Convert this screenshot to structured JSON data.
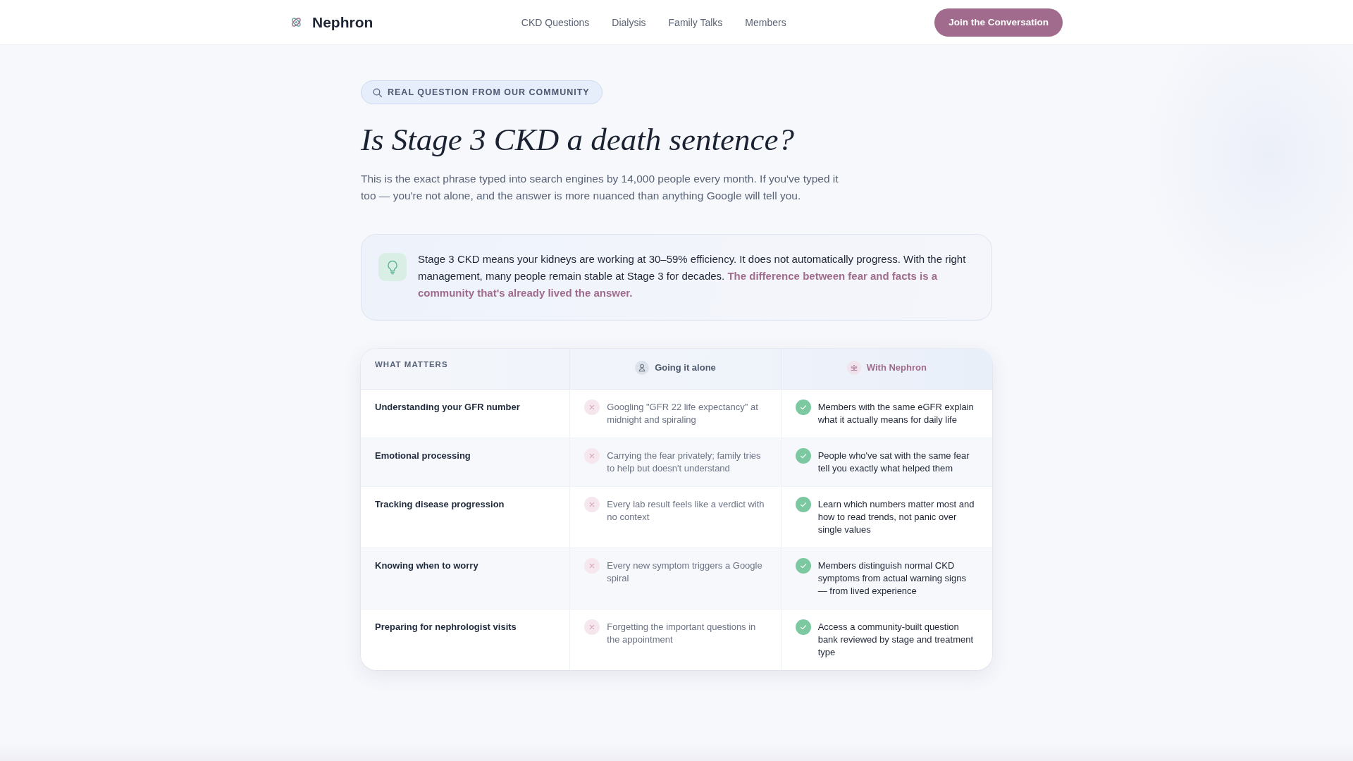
{
  "header": {
    "brand": "Nephron",
    "nav": [
      {
        "label": "CKD Questions"
      },
      {
        "label": "Dialysis"
      },
      {
        "label": "Family Talks"
      },
      {
        "label": "Members"
      }
    ],
    "cta": "Join the Conversation"
  },
  "hero": {
    "badge": "REAL QUESTION FROM OUR COMMUNITY",
    "title": "Is Stage 3 CKD a death sentence?",
    "intro": "This is the exact phrase typed into search engines by 14,000 people every month. If you've typed it too — you're not alone, and the answer is more nuanced than anything Google will tell you."
  },
  "callout": {
    "text": "Stage 3 CKD means your kidneys are working at 30–59% efficiency. It does not automatically progress. With the right management, many people remain stable at Stage 3 for decades. **The difference between fear and facts is a community that's already lived the answer.**"
  },
  "comparison": {
    "columns": [
      {
        "label": "WHAT MATTERS",
        "kind": "criterion"
      },
      {
        "label": "Going it alone",
        "kind": "negative"
      },
      {
        "label": "With Nephron",
        "kind": "positive"
      }
    ],
    "rows": [
      {
        "cells": [
          "Understanding your GFR number",
          "Googling \"GFR 22 life expectancy\" at midnight and spiraling",
          "Members with the same eGFR explain what it actually means for daily life"
        ]
      },
      {
        "cells": [
          "Emotional processing",
          "Carrying the fear privately; family tries to help but doesn't understand",
          "People who've sat with the same fear tell you exactly what helped them"
        ]
      },
      {
        "cells": [
          "Tracking disease progression",
          "Every lab result feels like a verdict with no context",
          "Learn which numbers matter most and how to read trends, not panic over single values"
        ]
      },
      {
        "cells": [
          "Knowing when to worry",
          "Every new symptom triggers a Google spiral",
          "Members distinguish normal CKD symptoms from actual warning signs — from lived experience"
        ]
      },
      {
        "cells": [
          "Preparing for nephrologist visits",
          "Forgetting the important questions in the appointment",
          "Access a community-built question bank reviewed by stage and treatment type"
        ]
      }
    ]
  }
}
